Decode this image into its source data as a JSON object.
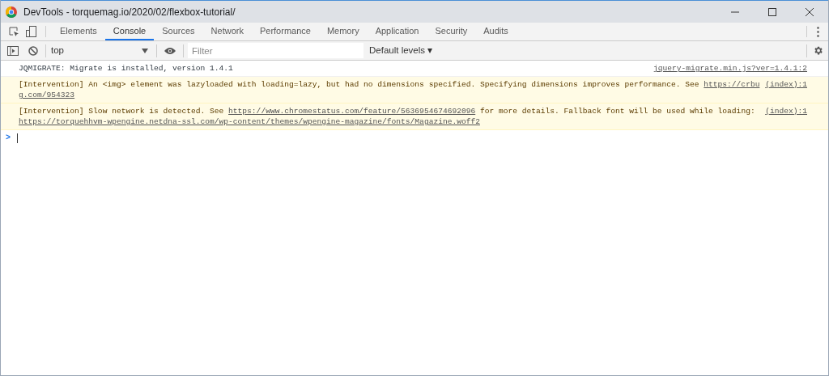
{
  "window": {
    "title": "DevTools - torquemag.io/2020/02/flexbox-tutorial/"
  },
  "tabs": [
    {
      "label": "Elements",
      "selected": false
    },
    {
      "label": "Console",
      "selected": true
    },
    {
      "label": "Sources",
      "selected": false
    },
    {
      "label": "Network",
      "selected": false
    },
    {
      "label": "Performance",
      "selected": false
    },
    {
      "label": "Memory",
      "selected": false
    },
    {
      "label": "Application",
      "selected": false
    },
    {
      "label": "Security",
      "selected": false
    },
    {
      "label": "Audits",
      "selected": false
    }
  ],
  "toolbar": {
    "context": "top",
    "filter": {
      "placeholder": "Filter"
    },
    "levels": "Default levels ▾"
  },
  "messages": [
    {
      "kind": "log",
      "source": "jquery-migrate.min.js?ver=1.4.1:2",
      "lines": [
        [
          {
            "kind": "text",
            "text": "JQMIGRATE: Migrate is installed, version 1.4.1"
          }
        ]
      ]
    },
    {
      "kind": "warning",
      "source": "(index):1",
      "lines": [
        [
          {
            "kind": "text",
            "text": "[Intervention] An <img> element was lazyloaded with loading=lazy, but had no dimensions specified. Specifying dimensions improves performance. See "
          },
          {
            "kind": "link",
            "text": "https://crbu"
          }
        ],
        [
          {
            "kind": "link",
            "text": "g.com/954323"
          }
        ]
      ]
    },
    {
      "kind": "warning",
      "source": "(index):1",
      "lines": [
        [
          {
            "kind": "text",
            "text": "[Intervention] Slow network is detected. See "
          },
          {
            "kind": "link",
            "text": "https://www.chromestatus.com/feature/5636954674692096"
          },
          {
            "kind": "text",
            "text": " for more details. Fallback font will be used while loading:"
          }
        ],
        [
          {
            "kind": "link",
            "text": "https://torquehhvm-wpengine.netdna-ssl.com/wp-content/themes/wpengine-magazine/fonts/Magazine.woff2"
          }
        ]
      ]
    }
  ],
  "prompt": {
    "symbol": ">"
  }
}
